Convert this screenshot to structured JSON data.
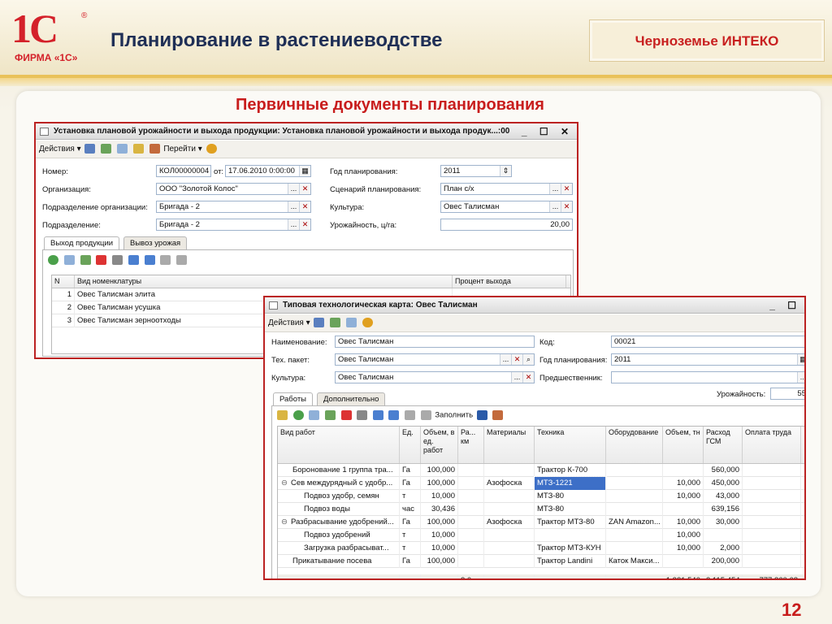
{
  "header": {
    "logo_text": "1С",
    "logo_reg": "®",
    "firm": "ФИРМА «1С»",
    "title": "Планирование в растениеводстве",
    "company": "Черноземье ИНТЕКО"
  },
  "subtitle": "Первичные документы планирования",
  "page_number": "12",
  "win1": {
    "title": "Установка плановой урожайности и выхода продукции: Установка плановой урожайности и выхода продук...:00",
    "toolbar": {
      "actions": "Действия ▾",
      "goto": "Перейти ▾"
    },
    "labels": {
      "number": "Номер:",
      "from": "от:",
      "org": "Организация:",
      "org_unit": "Подразделение организации:",
      "unit": "Подразделение:",
      "plan_year": "Год планирования:",
      "scenario": "Сценарий планирования:",
      "culture": "Культура:",
      "yield": "Урожайность, ц/га:"
    },
    "values": {
      "number": "КОЛ00000004",
      "date": "17.06.2010  0:00:00",
      "org": "ООО \"Золотой Колос\"",
      "org_unit": "Бригада - 2",
      "unit": "Бригада - 2",
      "plan_year": "2011",
      "scenario": "План с/х",
      "culture": "Овес Талисман",
      "yield": "20,00"
    },
    "tabs": [
      "Выход продукции",
      "Вывоз урожая"
    ],
    "table": {
      "headers": [
        "N",
        "Вид номенклатуры",
        "Процент выхода"
      ],
      "rows": [
        [
          "1",
          "Овес Талисман элита"
        ],
        [
          "2",
          "Овес Талисман  усушка"
        ],
        [
          "3",
          "Овес Талисман зерноотходы"
        ]
      ]
    }
  },
  "win2": {
    "title": "Типовая технологическая карта: Овес Талисман",
    "toolbar": {
      "actions": "Действия ▾",
      "fill": "Заполнить"
    },
    "labels": {
      "name": "Наименование:",
      "code": "Код:",
      "tech": "Тех. пакет:",
      "plan_year": "Год планирования:",
      "culture": "Культура:",
      "predecessor": "Предшественник:",
      "yield": "Урожайность:"
    },
    "values": {
      "name": "Овес Талисман",
      "code": "00021",
      "tech": "Овес Талисман",
      "plan_year": "2011",
      "culture": "Овес Талисман",
      "predecessor": "",
      "yield": "55"
    },
    "tabs": [
      "Работы",
      "Дополнительно"
    ],
    "table": {
      "headers": [
        "Вид работ",
        "Ед.",
        "Объем, в ед. работ",
        "Ра... км",
        "Материалы",
        "Техника",
        "Оборудование",
        "Объем, тн",
        "Расход ГСМ",
        "Оплата труда"
      ],
      "rows": [
        {
          "expand": "",
          "indent": 1,
          "cells": [
            "Боронование  1 группа  тра...",
            "Га",
            "100,000",
            "",
            "",
            "Трактор К-700",
            "",
            "",
            "560,000",
            ""
          ]
        },
        {
          "expand": "⊖",
          "indent": 0,
          "cells": [
            "Сев междурядный с удобр...",
            "Га",
            "100,000",
            "",
            "Азофоска",
            "МТЗ-1221",
            "",
            "10,000",
            "450,000",
            ""
          ]
        },
        {
          "expand": "",
          "indent": 2,
          "cells": [
            "Подвоз удобр, семян",
            "т",
            "10,000",
            "",
            "",
            "МТЗ-80",
            "",
            "10,000",
            "43,000",
            ""
          ]
        },
        {
          "expand": "",
          "indent": 2,
          "cells": [
            "Подвоз воды",
            "час",
            "30,436",
            "",
            "",
            "МТЗ-80",
            "",
            "",
            "639,156",
            ""
          ]
        },
        {
          "expand": "⊖",
          "indent": 0,
          "cells": [
            "Разбрасывание удобрений...",
            "Га",
            "100,000",
            "",
            "Азофоска",
            "Трактор МТЗ-80",
            "ZAN Amazon...",
            "10,000",
            "30,000",
            ""
          ]
        },
        {
          "expand": "",
          "indent": 2,
          "cells": [
            "Подвоз удобрений",
            "т",
            "10,000",
            "",
            "",
            "",
            "",
            "10,000",
            "",
            ""
          ]
        },
        {
          "expand": "",
          "indent": 2,
          "cells": [
            "Загрузка разбрасыват...",
            "т",
            "10,000",
            "",
            "",
            "Трактор МТЗ-КУН",
            "",
            "10,000",
            "2,000",
            ""
          ]
        },
        {
          "expand": "",
          "indent": 1,
          "cells": [
            "Прикатывание посева",
            "Га",
            "100,000",
            "",
            "",
            "Трактор Landini",
            "Каток Макси...",
            "",
            "200,000",
            ""
          ]
        }
      ],
      "footer": [
        "",
        "",
        "",
        "3,0",
        "",
        "",
        "",
        "1 231,540",
        "3 115,454",
        "777 860,68"
      ]
    }
  }
}
